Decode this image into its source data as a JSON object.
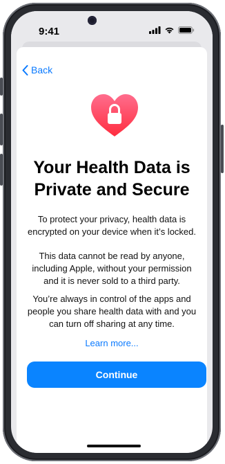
{
  "status_bar": {
    "time": "9:41",
    "icons": [
      "cellular-signal-icon",
      "wifi-icon",
      "battery-icon"
    ]
  },
  "nav": {
    "back_label": "Back"
  },
  "main": {
    "icon": "heart-lock-icon",
    "title": "Your Health Data is Private and Secure",
    "paragraphs": [
      "To protect your privacy, health data is encrypted on your device when it’s locked.",
      "This data cannot be read by anyone, including Apple, without your permission and it is never sold to a third party.",
      "You’re always in control of the apps and people you share health data with and you can turn off sharing at any time."
    ],
    "learn_more": "Learn more..."
  },
  "footer": {
    "continue_label": "Continue"
  },
  "colors": {
    "accent": "#0a84ff",
    "link": "#0a7aff",
    "heart_top": "#ff6d8d",
    "heart_bottom": "#ff2d3f"
  }
}
